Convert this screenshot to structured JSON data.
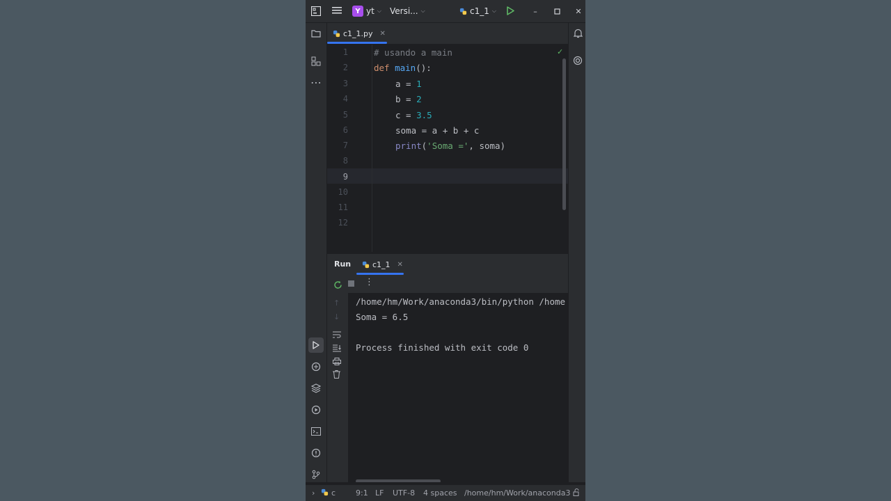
{
  "titlebar": {
    "project_badge": "Y",
    "project_name": "yt",
    "vcs_label": "Versi...",
    "run_config": "c1_1"
  },
  "editor": {
    "tab_label": "c1_1.py",
    "line_numbers": [
      "1",
      "2",
      "3",
      "4",
      "5",
      "6",
      "7",
      "8",
      "9",
      "10",
      "11",
      "12"
    ],
    "current_line": "9",
    "code": {
      "l1_comment": "# usando a main",
      "l2_kw": "def",
      "l2_fn": "main",
      "l2_rest": "():",
      "l3_a": "a = ",
      "l3_val": "1",
      "l4_b": "b = ",
      "l4_val": "2",
      "l5_c": "c = ",
      "l5_val": "3.5",
      "l6": "soma = a + b + c",
      "l7_fn": "print",
      "l7_open": "(",
      "l7_str": "'Soma ='",
      "l7_rest": ", soma)"
    }
  },
  "run_panel": {
    "title": "Run",
    "tab_label": "c1_1",
    "output": [
      "/home/hm/Work/anaconda3/bin/python /home",
      "Soma = 6.5",
      "",
      "Process finished with exit code 0"
    ]
  },
  "status_bar": {
    "breadcrumb": "c",
    "position": "9:1",
    "line_sep": "LF",
    "encoding": "UTF-8",
    "indent": "4 spaces",
    "interpreter": "/home/hm/Work/anaconda3"
  },
  "colors": {
    "accent": "#3574f0",
    "keyword": "#cf8e6d",
    "function": "#56a8f5",
    "number": "#2aacb8",
    "string": "#6aab73",
    "run_green": "#5fb865"
  }
}
